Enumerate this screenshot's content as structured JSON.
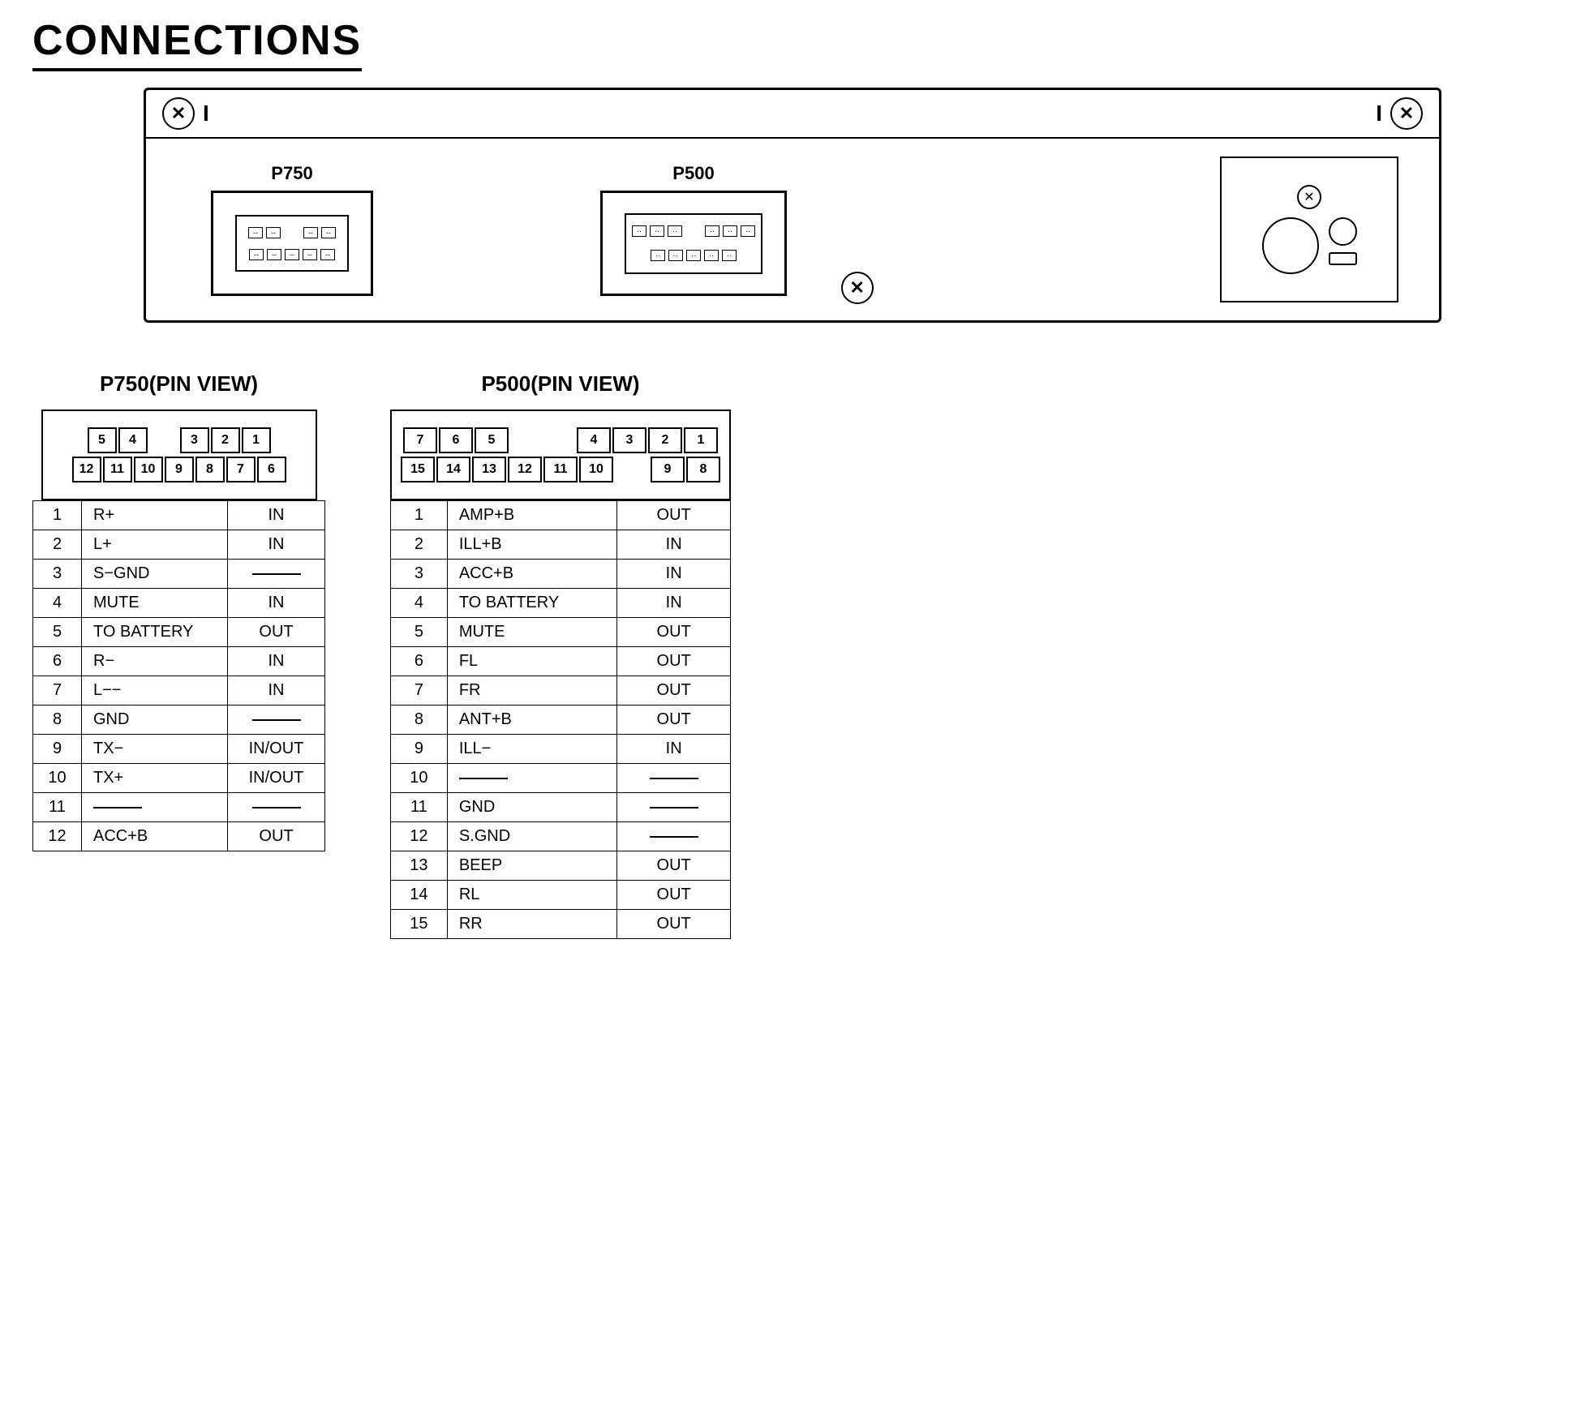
{
  "page": {
    "title": "CONNECTIONS"
  },
  "connectors": {
    "p750_label": "P750",
    "p500_label": "P500",
    "p750_pin_view_title": "P750(PIN VIEW)",
    "p500_pin_view_title": "P500(PIN VIEW)"
  },
  "p750_pin_view": {
    "row1": [
      "5",
      "4",
      "",
      "3",
      "2",
      "1"
    ],
    "row2": [
      "12",
      "11",
      "10",
      "9",
      "8",
      "7",
      "6"
    ]
  },
  "p500_pin_view": {
    "row1": [
      "7",
      "6",
      "5",
      "",
      "4",
      "3",
      "2",
      "1"
    ],
    "row2": [
      "15",
      "14",
      "13",
      "12",
      "11",
      "10",
      "",
      "9",
      "8"
    ]
  },
  "p750_table": [
    {
      "pin": "1",
      "signal": "R+",
      "dir": "IN"
    },
    {
      "pin": "2",
      "signal": "L+",
      "dir": "IN"
    },
    {
      "pin": "3",
      "signal": "S−GND",
      "dir": "—"
    },
    {
      "pin": "4",
      "signal": "MUTE",
      "dir": "IN"
    },
    {
      "pin": "5",
      "signal": "TO BATTERY",
      "dir": "OUT"
    },
    {
      "pin": "6",
      "signal": "R−",
      "dir": "IN"
    },
    {
      "pin": "7",
      "signal": "L−−",
      "dir": "IN"
    },
    {
      "pin": "8",
      "signal": "GND",
      "dir": "—"
    },
    {
      "pin": "9",
      "signal": "TX−",
      "dir": "IN/OUT"
    },
    {
      "pin": "10",
      "signal": "TX+",
      "dir": "IN/OUT"
    },
    {
      "pin": "11",
      "signal": "—",
      "dir": "—"
    },
    {
      "pin": "12",
      "signal": "ACC+B",
      "dir": "OUT"
    }
  ],
  "p500_table": [
    {
      "pin": "1",
      "signal": "AMP+B",
      "dir": "OUT"
    },
    {
      "pin": "2",
      "signal": "ILL+B",
      "dir": "IN"
    },
    {
      "pin": "3",
      "signal": "ACC+B",
      "dir": "IN"
    },
    {
      "pin": "4",
      "signal": "TO BATTERY",
      "dir": "IN"
    },
    {
      "pin": "5",
      "signal": "MUTE",
      "dir": "OUT"
    },
    {
      "pin": "6",
      "signal": "FL",
      "dir": "OUT"
    },
    {
      "pin": "7",
      "signal": "FR",
      "dir": "OUT"
    },
    {
      "pin": "8",
      "signal": "ANT+B",
      "dir": "OUT"
    },
    {
      "pin": "9",
      "signal": "ILL−",
      "dir": "IN"
    },
    {
      "pin": "10",
      "signal": "—",
      "dir": "—"
    },
    {
      "pin": "11",
      "signal": "GND",
      "dir": "—"
    },
    {
      "pin": "12",
      "signal": "S.GND",
      "dir": "—"
    },
    {
      "pin": "13",
      "signal": "BEEP",
      "dir": "OUT"
    },
    {
      "pin": "14",
      "signal": "RL",
      "dir": "OUT"
    },
    {
      "pin": "15",
      "signal": "RR",
      "dir": "OUT"
    }
  ]
}
